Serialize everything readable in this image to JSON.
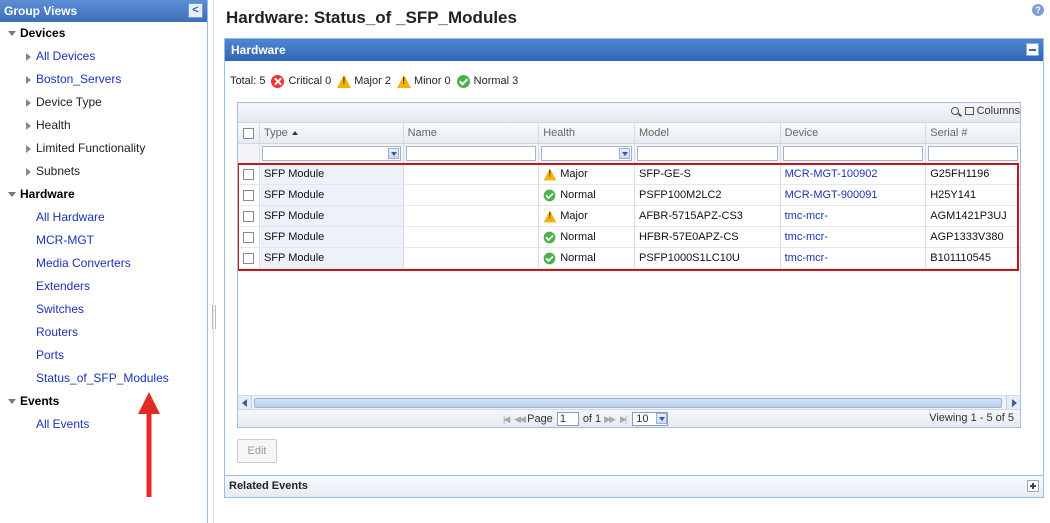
{
  "sidebar": {
    "title": "Group Views",
    "collapse_label": "<",
    "groups": [
      {
        "label": "Devices",
        "items": [
          {
            "label": "All Devices",
            "link": true
          },
          {
            "label": "Boston_Servers",
            "link": true
          },
          {
            "label": "Device Type",
            "link": false
          },
          {
            "label": "Health",
            "link": false
          },
          {
            "label": "Limited Functionality",
            "link": false
          },
          {
            "label": "Subnets",
            "link": false
          }
        ]
      },
      {
        "label": "Hardware",
        "items": [
          {
            "label": "All Hardware"
          },
          {
            "label": "MCR-MGT"
          },
          {
            "label": "Media Converters"
          },
          {
            "label": "Extenders"
          },
          {
            "label": "Switches"
          },
          {
            "label": "Routers"
          },
          {
            "label": "Ports"
          },
          {
            "label": "Status_of_SFP_Modules"
          }
        ]
      },
      {
        "label": "Events",
        "items": [
          {
            "label": "All Events"
          }
        ]
      }
    ]
  },
  "page": {
    "title": "Hardware: Status_of _SFP_Modules",
    "help_icon": "help-icon"
  },
  "panel": {
    "title": "Hardware",
    "summary": {
      "total_label": "Total: 5",
      "critical_label": "Critical 0",
      "major_label": "Major 2",
      "minor_label": "Minor 0",
      "normal_label": "Normal 3"
    },
    "grid": {
      "columns_button": "Columns",
      "headers": [
        "Type",
        "Name",
        "Health",
        "Model",
        "Device",
        "Serial #"
      ],
      "rows": [
        {
          "type": "SFP Module",
          "name": "",
          "health": "Major",
          "health_icon": "warning-icon",
          "model": "SFP-GE-S",
          "device": "MCR-MGT-100902",
          "serial": "G25FH1196"
        },
        {
          "type": "SFP Module",
          "name": "",
          "health": "Normal",
          "health_icon": "ok-icon",
          "model": "PSFP100M2LC2",
          "device": "MCR-MGT-900091",
          "serial": "H25Y141"
        },
        {
          "type": "SFP Module",
          "name": "",
          "health": "Major",
          "health_icon": "warning-icon",
          "model": "AFBR-5715APZ-CS3",
          "device": "tmc-mcr-",
          "serial": "AGM1421P3UJ"
        },
        {
          "type": "SFP Module",
          "name": "",
          "health": "Normal",
          "health_icon": "ok-icon",
          "model": "HFBR-57E0APZ-CS",
          "device": "tmc-mcr-",
          "serial": "AGP1333V380"
        },
        {
          "type": "SFP Module",
          "name": "",
          "health": "Normal",
          "health_icon": "ok-icon",
          "model": "PSFP1000S1LC10U",
          "device": "tmc-mcr-",
          "serial": "B101110545"
        }
      ],
      "pager": {
        "page_label": "Page",
        "page_value": "1",
        "of_label": "of 1",
        "page_size": "10",
        "viewing": "Viewing 1 - 5 of 5"
      }
    },
    "edit_label": "Edit",
    "related_events_label": "Related Events"
  },
  "colors": {
    "header_blue": "#3c6fb8",
    "link_blue": "#1a33b8",
    "highlight_red": "#c2181c",
    "critical": "#ee3333",
    "major": "#f3b300",
    "normal": "#4cb14b"
  }
}
